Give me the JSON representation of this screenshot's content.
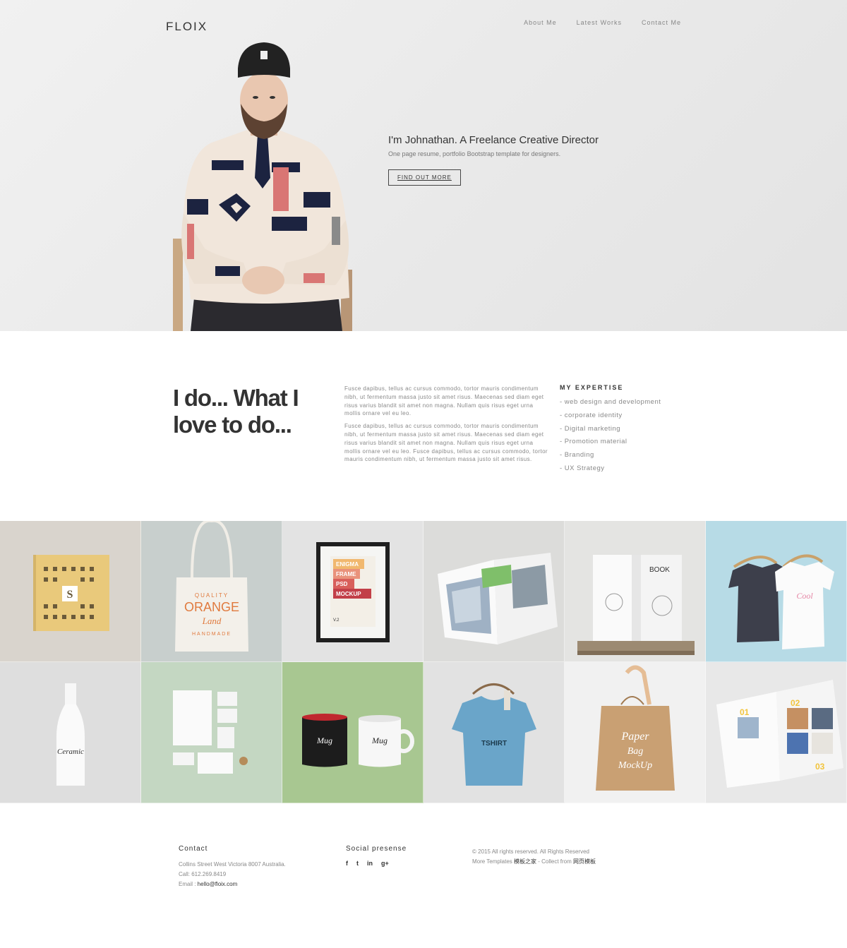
{
  "brand": {
    "logo": "FLOIX"
  },
  "nav": {
    "items": [
      "About Me",
      "Latest Works",
      "Contact Me"
    ]
  },
  "hero": {
    "title": "I'm Johnathan. A Freelance Creative Director",
    "subtitle": "One page resume, portfolio Bootstrap template for designers.",
    "button": "FIND OUT MORE"
  },
  "about": {
    "heading": "I do... What I love to do...",
    "paragraphs": [
      "Fusce dapibus, tellus ac cursus commodo, tortor mauris condimentum nibh, ut fermentum massa justo sit amet risus. Maecenas sed diam eget risus varius blandit sit amet non magna. Nullam quis risus eget urna mollis ornare vel eu leo.",
      "Fusce dapibus, tellus ac cursus commodo, tortor mauris condimentum nibh, ut fermentum massa justo sit amet risus. Maecenas sed diam eget risus varius blandit sit amet non magna. Nullam quis risus eget urna mollis ornare vel eu leo. Fusce dapibus, tellus ac cursus commodo, tortor mauris condimentum nibh, ut fermentum massa justo sit amet risus."
    ],
    "expertise_title": "MY EXPERTISE",
    "expertise": [
      "- web design and development",
      "- corporate identity",
      "- Digital marketing",
      "- Promotion material",
      "- Branding",
      "- UX Strategy"
    ]
  },
  "portfolio": {
    "tile_labels": {
      "book": "S",
      "tote_line1": "QUALITY",
      "tote_line2": "ORANGE",
      "tote_line3": "Land",
      "tote_line4": "HANDMADE",
      "frame_lines": [
        "ENIGMA",
        "FRAME",
        "PSD",
        "MOCKUP"
      ],
      "frame_version": "V.2",
      "book_cover": "BOOK",
      "bottle": "Ceramic",
      "mug": "Mug",
      "tshirt": "TSHIRT",
      "bag_line1": "Paper",
      "bag_line2": "Bag",
      "bag_line3": "MockUp",
      "mag_num1": "01",
      "mag_num2": "02",
      "mag_num3": "03"
    }
  },
  "footer": {
    "contact_title": "Contact",
    "address": "Collins Street West Victoria 8007 Australia.",
    "phone": "Call: 612.269.8419",
    "email_label": "Email : ",
    "email": "hello@floix.com",
    "social_title": "Social presense",
    "social_icons": [
      "f",
      "t",
      "in",
      "g+"
    ],
    "copyright": "© 2015 All rights reserved. All Rights Reserved",
    "more_prefix": "More Templates ",
    "more_link1": "模板之家",
    "more_mid": " - Collect from ",
    "more_link2": "网页模板"
  }
}
